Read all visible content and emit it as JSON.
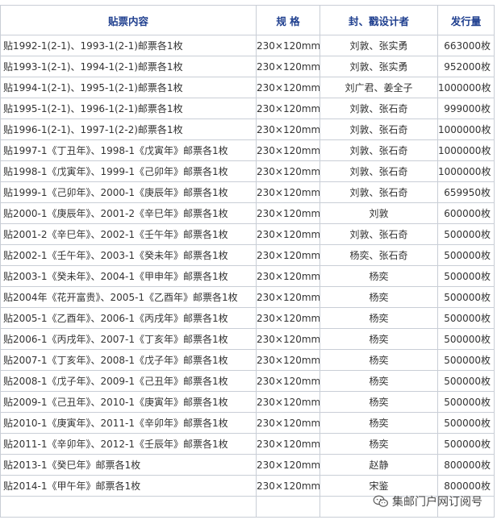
{
  "table": {
    "headers": {
      "name": "贴票内容",
      "spec": "规 格",
      "design": "封、戳设计者",
      "qty": "发行量"
    },
    "rows": [
      {
        "name": "贴1992-1(2-1)、1993-1(2-1)邮票各1枚",
        "spec": "230×120mm",
        "design": "刘敦、张实勇",
        "qty": "663000枚"
      },
      {
        "name": "贴1993-1(2-1)、1994-1(2-1)邮票各1枚",
        "spec": "230×120mm",
        "design": "刘敦、张实勇",
        "qty": "952000枚"
      },
      {
        "name": "贴1994-1(2-1)、1995-1(2-1)邮票各1枚",
        "spec": "230×120mm",
        "design": "刘广君、姜全子",
        "qty": "1000000枚"
      },
      {
        "name": "贴1995-1(2-1)、1996-1(2-1)邮票各1枚",
        "spec": "230×120mm",
        "design": "刘敦、张石奇",
        "qty": "999000枚"
      },
      {
        "name": "贴1996-1(2-1)、1997-1(2-2)邮票各1枚",
        "spec": "230×120mm",
        "design": "刘敦、张石奇",
        "qty": "1000000枚"
      },
      {
        "name": "贴1997-1《丁丑年》、1998-1《戊寅年》邮票各1枚",
        "spec": "230×120mm",
        "design": "刘敦、张石奇",
        "qty": "1000000枚"
      },
      {
        "name": "贴1998-1《戊寅年》、1999-1《己卯年》邮票各1枚",
        "spec": "230×120mm",
        "design": "刘敦、张石奇",
        "qty": "1000000枚"
      },
      {
        "name": "贴1999-1《己卯年》、2000-1《庚辰年》邮票各1枚",
        "spec": "230×120mm",
        "design": "刘敦、张石奇",
        "qty": "659950枚"
      },
      {
        "name": "贴2000-1《庚辰年》、2001-2《辛巳年》邮票各1枚",
        "spec": "230×120mm",
        "design": "刘敦",
        "qty": "600000枚"
      },
      {
        "name": "贴2001-2《辛巳年》、2002-1《壬午年》邮票各1枚",
        "spec": "230×120mm",
        "design": "刘敦、张石奇",
        "qty": "500000枚"
      },
      {
        "name": "贴2002-1《壬午年》、2003-1《癸未年》邮票各1枚",
        "spec": "230×120mm",
        "design": "杨奕、张石奇",
        "qty": "500000枚"
      },
      {
        "name": "贴2003-1《癸未年》、2004-1《甲申年》邮票各1枚",
        "spec": "230×120mm",
        "design": "杨奕",
        "qty": "500000枚"
      },
      {
        "name": "贴2004年《花开富贵》、2005-1《乙酉年》邮票各1枚",
        "spec": "230×120mm",
        "design": "杨奕",
        "qty": "500000枚"
      },
      {
        "name": "贴2005-1《乙酉年》、2006-1《丙戌年》邮票各1枚",
        "spec": "230×120mm",
        "design": "杨奕",
        "qty": "500000枚"
      },
      {
        "name": "贴2006-1《丙戌年》、2007-1《丁亥年》邮票各1枚",
        "spec": "230×120mm",
        "design": "杨奕",
        "qty": "500000枚"
      },
      {
        "name": "贴2007-1《丁亥年》、2008-1《戊子年》邮票各1枚",
        "spec": "230×120mm",
        "design": "杨奕",
        "qty": "500000枚"
      },
      {
        "name": "贴2008-1《戊子年》、2009-1《己丑年》邮票各1枚",
        "spec": "230×120mm",
        "design": "杨奕",
        "qty": "500000枚"
      },
      {
        "name": "贴2009-1《己丑年》、2010-1《庚寅年》邮票各1枚",
        "spec": "230×120mm",
        "design": "杨奕",
        "qty": "500000枚"
      },
      {
        "name": "贴2010-1《庚寅年》、2011-1《辛卯年》邮票各1枚",
        "spec": "230×120mm",
        "design": "杨奕",
        "qty": "500000枚"
      },
      {
        "name": "贴2011-1《辛卯年》、2012-1《壬辰年》邮票各1枚",
        "spec": "230×120mm",
        "design": "杨奕",
        "qty": "500000枚"
      },
      {
        "name": "贴2013-1《癸巳年》邮票各1枚",
        "spec": "230×120mm",
        "design": "赵静",
        "qty": "800000枚"
      },
      {
        "name": "贴2014-1《甲午年》邮票各1枚",
        "spec": "230×120mm",
        "design": "宋鉴",
        "qty": "800000枚"
      }
    ]
  },
  "watermark": {
    "text": "集邮门户网订阅号",
    "icon": "wechat-icon"
  }
}
